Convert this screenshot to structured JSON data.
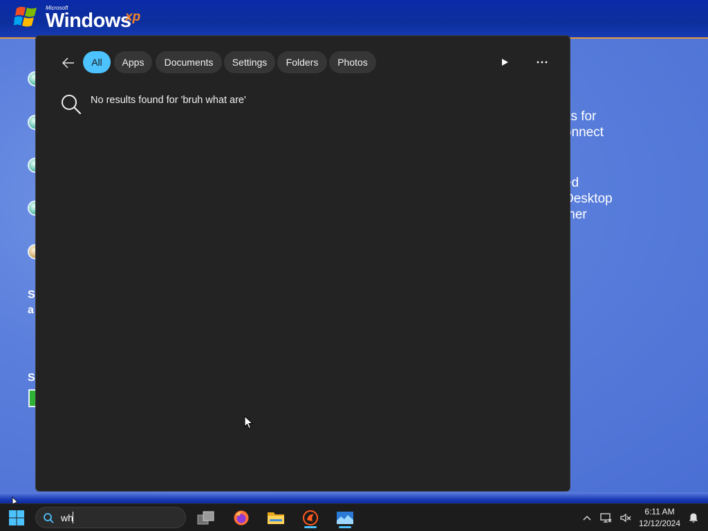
{
  "xp_background": {
    "brand_small": "Microsoft",
    "brand_name": "Windows",
    "brand_suffix": "xp",
    "right_text_block_1": "its for\nonnect",
    "right_text_block_2": "ed\nDesktop\nther",
    "left_letters": [
      "S",
      "a",
      "S"
    ]
  },
  "search_flyout": {
    "filters": [
      "All",
      "Apps",
      "Documents",
      "Settings",
      "Folders",
      "Photos"
    ],
    "active_filter": "All",
    "no_results_text": "No results found for 'bruh what are'"
  },
  "taskbar": {
    "search_value": "wh",
    "pinned_apps": [
      "task-view",
      "firefox",
      "file-explorer",
      "gimp-like-app",
      "remote-desktop-app"
    ],
    "clock_time": "6:11 AM",
    "clock_date": "12/12/2024"
  },
  "colors": {
    "accent": "#4cc2ff",
    "flyout_bg": "#232323",
    "taskbar_bg": "#1c1c1c",
    "xp_blue": "#5a7edc"
  }
}
